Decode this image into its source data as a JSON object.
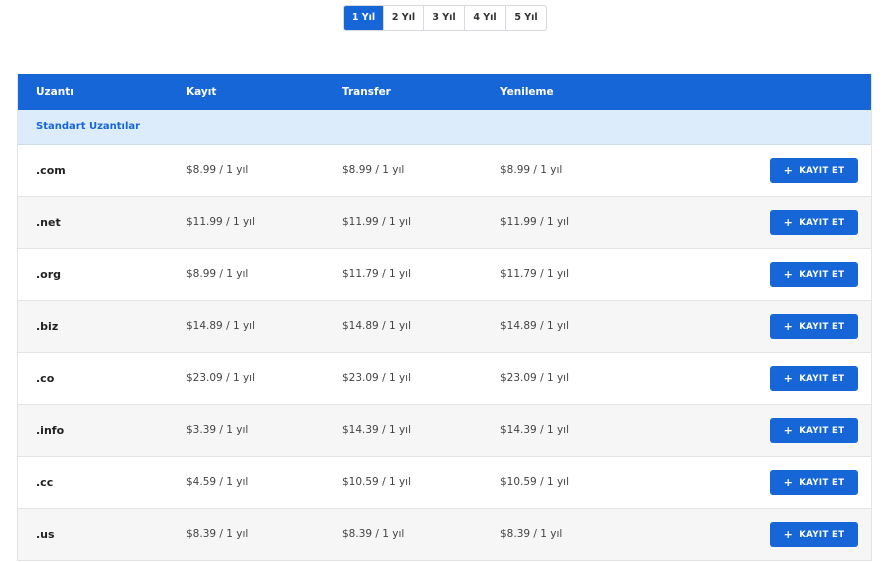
{
  "year_tabs": [
    {
      "label": "1 Yıl",
      "active": true
    },
    {
      "label": "2 Yıl",
      "active": false
    },
    {
      "label": "3 Yıl",
      "active": false
    },
    {
      "label": "4 Yıl",
      "active": false
    },
    {
      "label": "5 Yıl",
      "active": false
    }
  ],
  "table": {
    "headers": {
      "extension": "Uzantı",
      "register": "Kayıt",
      "transfer": "Transfer",
      "renewal": "Yenileme"
    },
    "group_label": "Standart Uzantılar",
    "button_label": "KAYIT ET",
    "button_icon": "plus-icon",
    "rows": [
      {
        "ext": ".com",
        "register": "$8.99 / 1 yıl",
        "transfer": "$8.99 / 1 yıl",
        "renewal": "$8.99 / 1 yıl"
      },
      {
        "ext": ".net",
        "register": "$11.99 / 1 yıl",
        "transfer": "$11.99 / 1 yıl",
        "renewal": "$11.99 / 1 yıl"
      },
      {
        "ext": ".org",
        "register": "$8.99 / 1 yıl",
        "transfer": "$11.79 / 1 yıl",
        "renewal": "$11.79 / 1 yıl"
      },
      {
        "ext": ".biz",
        "register": "$14.89 / 1 yıl",
        "transfer": "$14.89 / 1 yıl",
        "renewal": "$14.89 / 1 yıl"
      },
      {
        "ext": ".co",
        "register": "$23.09 / 1 yıl",
        "transfer": "$23.09 / 1 yıl",
        "renewal": "$23.09 / 1 yıl"
      },
      {
        "ext": ".info",
        "register": "$3.39 / 1 yıl",
        "transfer": "$14.39 / 1 yıl",
        "renewal": "$14.39 / 1 yıl"
      },
      {
        "ext": ".cc",
        "register": "$4.59 / 1 yıl",
        "transfer": "$10.59 / 1 yıl",
        "renewal": "$10.59 / 1 yıl"
      },
      {
        "ext": ".us",
        "register": "$8.39 / 1 yıl",
        "transfer": "$8.39 / 1 yıl",
        "renewal": "$8.39 / 1 yıl"
      }
    ]
  },
  "colors": {
    "accent": "#1666d8",
    "group_bg": "#dcecfb",
    "row_alt_bg": "#f6f6f7"
  }
}
